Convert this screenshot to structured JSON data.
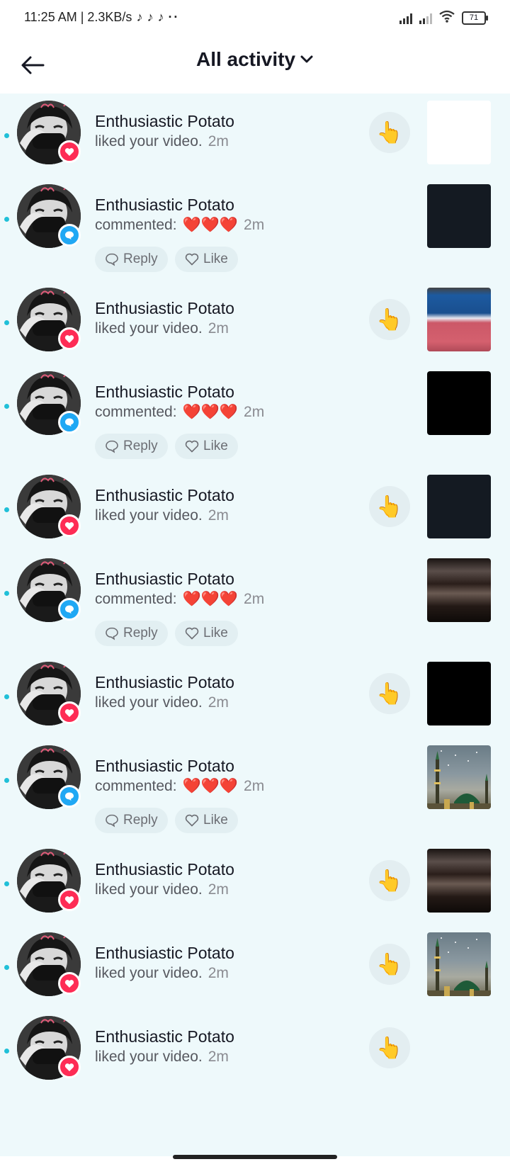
{
  "status_bar": {
    "time": "11:25 AM | 2.3KB/s",
    "battery": "71",
    "extra_dots": "··"
  },
  "header": {
    "title": "All activity",
    "back_icon": "arrow-left-icon",
    "dropdown_icon": "chevron-down-icon"
  },
  "colors": {
    "list_bg": "#eef9fb",
    "like_badge": "#fe2c55",
    "comment_badge": "#20a8f4",
    "unread_dot": "#20c0d8"
  },
  "actions": {
    "reply_label": "Reply",
    "like_label": "Like",
    "wave_icon": "👆",
    "hearts": "❤️❤️❤️"
  },
  "notifications": [
    {
      "user": "Enthusiastic Potato",
      "type": "like",
      "text": "liked your video.",
      "time": "2m",
      "thumb": "white"
    },
    {
      "user": "Enthusiastic Potato",
      "type": "comment",
      "text": "commented:",
      "time": "2m",
      "thumb": "dark"
    },
    {
      "user": "Enthusiastic Potato",
      "type": "like",
      "text": "liked your video.",
      "time": "2m",
      "thumb": "flag"
    },
    {
      "user": "Enthusiastic Potato",
      "type": "comment",
      "text": "commented:",
      "time": "2m",
      "thumb": "black"
    },
    {
      "user": "Enthusiastic Potato",
      "type": "like",
      "text": "liked your video.",
      "time": "2m",
      "thumb": "dark"
    },
    {
      "user": "Enthusiastic Potato",
      "type": "comment",
      "text": "commented:",
      "time": "2m",
      "thumb": "brown"
    },
    {
      "user": "Enthusiastic Potato",
      "type": "like",
      "text": "liked your video.",
      "time": "2m",
      "thumb": "black"
    },
    {
      "user": "Enthusiastic Potato",
      "type": "comment",
      "text": "commented:",
      "time": "2m",
      "thumb": "mosque"
    },
    {
      "user": "Enthusiastic Potato",
      "type": "like",
      "text": "liked your video.",
      "time": "2m",
      "thumb": "brown"
    },
    {
      "user": "Enthusiastic Potato",
      "type": "like",
      "text": "liked your video.",
      "time": "2m",
      "thumb": "mosque"
    },
    {
      "user": "Enthusiastic Potato",
      "type": "like",
      "text": "liked your video.",
      "time": "2m",
      "thumb": "none"
    }
  ]
}
